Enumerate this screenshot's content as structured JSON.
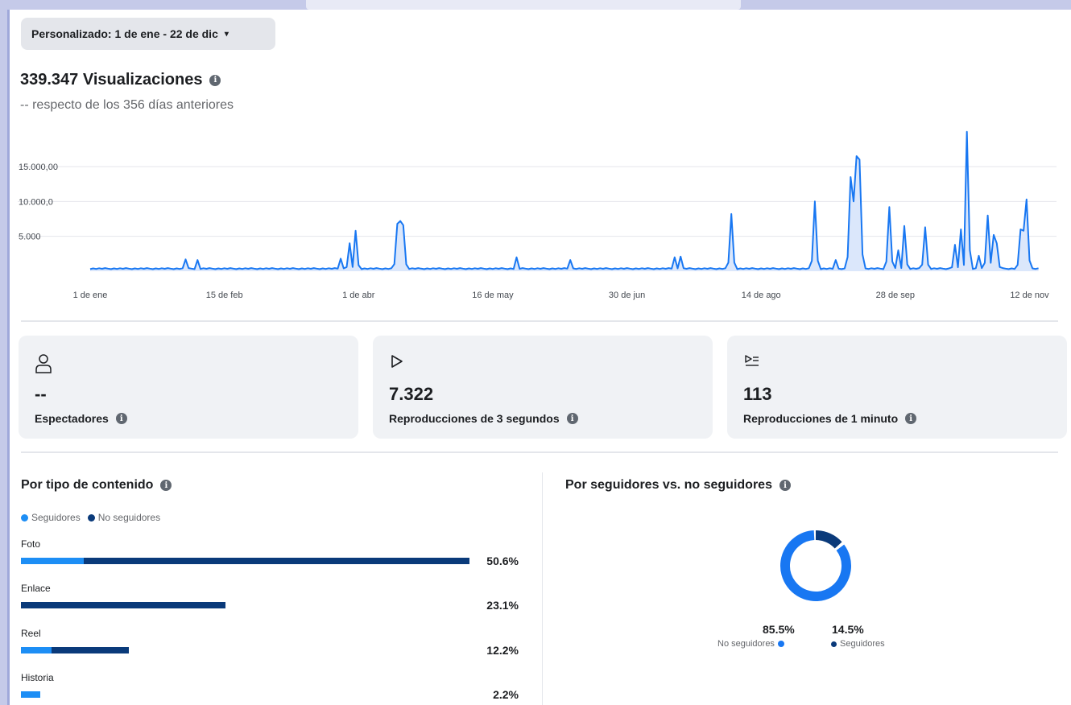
{
  "date_filter": {
    "label": "Personalizado: 1 de ene - 22 de dic",
    "caret": "▾"
  },
  "headline": {
    "value": "339.347 Visualizaciones",
    "info_icon": "i"
  },
  "comparison": "-- respecto de los 356 días anteriores",
  "chart_data": {
    "type": "area",
    "y_ticks": [
      "5.000",
      "10.000,0",
      "15.000,00"
    ],
    "y_tick_values": [
      5000,
      10000,
      15000
    ],
    "x_ticks": [
      "1 de ene",
      "15 de feb",
      "1 de abr",
      "16 de may",
      "30 de jun",
      "14 de ago",
      "28 de sep",
      "12 de nov"
    ],
    "x_tick_days": [
      0,
      45,
      90,
      135,
      180,
      225,
      270,
      315
    ],
    "ylim": [
      0,
      20000
    ],
    "xlim": [
      0,
      320
    ],
    "line_color": "#1877f2",
    "fill_color": "#dbe7fb",
    "grid": true,
    "peaks": [
      {
        "day": 32,
        "value": 1700
      },
      {
        "day": 36,
        "value": 1600
      },
      {
        "day": 84,
        "value": 1800
      },
      {
        "day": 87,
        "value": 4000
      },
      {
        "day": 89,
        "value": 5800
      },
      {
        "day": 103,
        "value": 6800
      },
      {
        "day": 104,
        "value": 7200
      },
      {
        "day": 105,
        "value": 6600
      },
      {
        "day": 143,
        "value": 2000
      },
      {
        "day": 161,
        "value": 1600
      },
      {
        "day": 196,
        "value": 2000
      },
      {
        "day": 198,
        "value": 2100
      },
      {
        "day": 215,
        "value": 8200
      },
      {
        "day": 243,
        "value": 10000
      },
      {
        "day": 250,
        "value": 1600
      },
      {
        "day": 255,
        "value": 13500
      },
      {
        "day": 256,
        "value": 10000
      },
      {
        "day": 257,
        "value": 16500
      },
      {
        "day": 258,
        "value": 16000
      },
      {
        "day": 268,
        "value": 9200
      },
      {
        "day": 271,
        "value": 3000
      },
      {
        "day": 273,
        "value": 6500
      },
      {
        "day": 280,
        "value": 6300
      },
      {
        "day": 290,
        "value": 3800
      },
      {
        "day": 292,
        "value": 6000
      },
      {
        "day": 294,
        "value": 20000
      },
      {
        "day": 298,
        "value": 2200
      },
      {
        "day": 301,
        "value": 8000
      },
      {
        "day": 303,
        "value": 5200
      },
      {
        "day": 304,
        "value": 4000
      },
      {
        "day": 312,
        "value": 6000
      },
      {
        "day": 313,
        "value": 5800
      },
      {
        "day": 314,
        "value": 10300
      }
    ]
  },
  "metrics": [
    {
      "icon": "person-icon",
      "value": "--",
      "label": "Espectadores"
    },
    {
      "icon": "play-icon",
      "value": "7.322",
      "label": "Reproducciones de 3 segundos"
    },
    {
      "icon": "playlist-icon",
      "value": "113",
      "label": "Reproducciones de 1 minuto"
    }
  ],
  "content_type": {
    "title": "Por tipo de contenido",
    "legend": [
      {
        "label": "Seguidores",
        "color": "#1d8ef5"
      },
      {
        "label": "No seguidores",
        "color": "#0a3a7a"
      }
    ],
    "rows": [
      {
        "label": "Foto",
        "pct": "50.6%",
        "total": 50.6,
        "followers_share": 0.14
      },
      {
        "label": "Enlace",
        "pct": "23.1%",
        "total": 23.1,
        "followers_share": 0.0
      },
      {
        "label": "Reel",
        "pct": "12.2%",
        "total": 12.2,
        "followers_share": 0.28
      },
      {
        "label": "Historia",
        "pct": "2.2%",
        "total": 2.2,
        "followers_share": 1.0
      }
    ]
  },
  "followers_split": {
    "title": "Por seguidores vs. no seguidores",
    "no_followers": {
      "pct": "85.5%",
      "label": "No seguidores",
      "value": 85.5,
      "color": "#1877f2"
    },
    "followers": {
      "pct": "14.5%",
      "label": "Seguidores",
      "value": 14.5,
      "color": "#0a3a7a"
    }
  }
}
